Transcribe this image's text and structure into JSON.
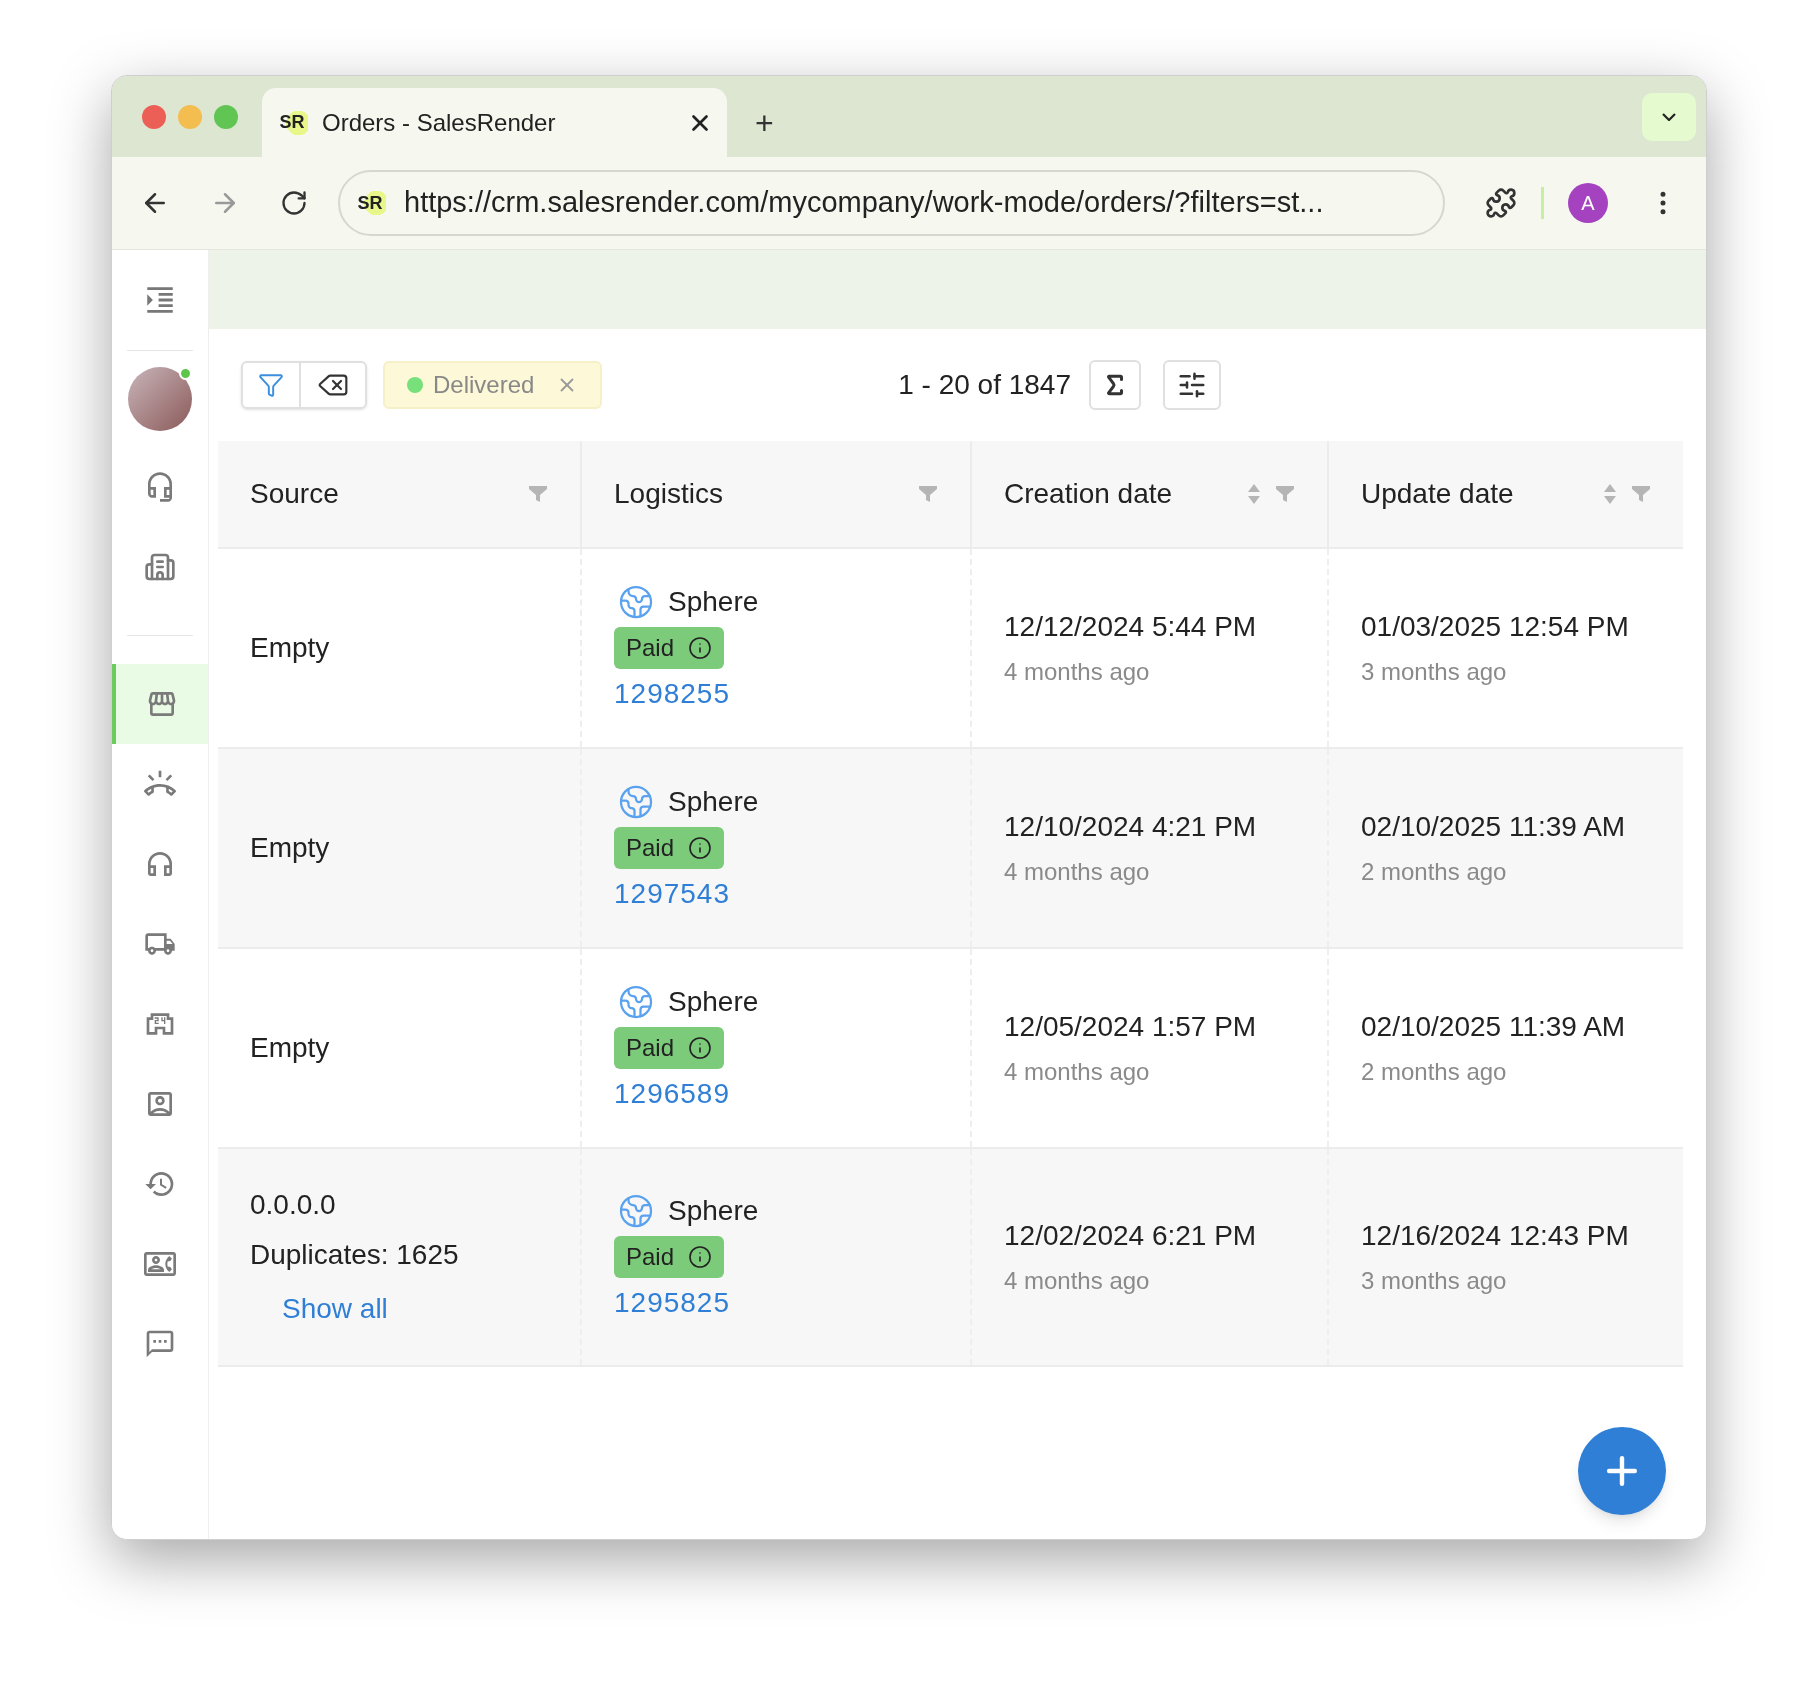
{
  "browser": {
    "tab": {
      "favicon": "SR",
      "title": "Orders - SalesRender",
      "new_tab": "+"
    },
    "url": "https://crm.salesrender.com/mycompany/work-mode/orders/?filters=st...",
    "site_badge": "SR",
    "profile": "A"
  },
  "sidebar": {
    "user": {
      "online": true
    },
    "top_items": [
      {
        "selected": false
      },
      {
        "selected": false
      }
    ],
    "items": [
      {
        "selected": true
      },
      {
        "selected": false
      },
      {
        "selected": false
      },
      {
        "selected": false
      },
      {
        "selected": false
      },
      {
        "selected": false
      },
      {
        "selected": false
      },
      {
        "selected": false
      },
      {
        "selected": false
      }
    ]
  },
  "toolbar": {
    "filter_chip": {
      "label": "Delivered",
      "color": "#77e07a"
    },
    "pagination": "1 - 20 of 1847"
  },
  "table": {
    "columns": [
      {
        "label": "Source",
        "sortable": false
      },
      {
        "label": "Logistics",
        "sortable": false
      },
      {
        "label": "Creation date",
        "sortable": true
      },
      {
        "label": "Update date",
        "sortable": true
      }
    ],
    "rows": [
      {
        "source": {
          "lines": [
            "Empty"
          ]
        },
        "logistics": {
          "carrier": "Sphere",
          "status": "Paid",
          "number": "1298255"
        },
        "created": {
          "date": "12/12/2024 5:44 PM",
          "relative": "4 months ago"
        },
        "updated": {
          "date": "01/03/2025 12:54 PM",
          "relative": "3 months ago"
        }
      },
      {
        "source": {
          "lines": [
            "Empty"
          ]
        },
        "logistics": {
          "carrier": "Sphere",
          "status": "Paid",
          "number": "1297543"
        },
        "created": {
          "date": "12/10/2024 4:21 PM",
          "relative": "4 months ago"
        },
        "updated": {
          "date": "02/10/2025 11:39 AM",
          "relative": "2 months ago"
        }
      },
      {
        "source": {
          "lines": [
            "Empty"
          ]
        },
        "logistics": {
          "carrier": "Sphere",
          "status": "Paid",
          "number": "1296589"
        },
        "created": {
          "date": "12/05/2024 1:57 PM",
          "relative": "4 months ago"
        },
        "updated": {
          "date": "02/10/2025 11:39 AM",
          "relative": "2 months ago"
        }
      },
      {
        "source": {
          "lines": [
            "0.0.0.0",
            "Duplicates: 1625"
          ],
          "link": "Show all"
        },
        "logistics": {
          "carrier": "Sphere",
          "status": "Paid",
          "number": "1295825"
        },
        "created": {
          "date": "12/02/2024 6:21 PM",
          "relative": "4 months ago"
        },
        "updated": {
          "date": "12/16/2024 12:43 PM",
          "relative": "3 months ago"
        }
      }
    ]
  }
}
